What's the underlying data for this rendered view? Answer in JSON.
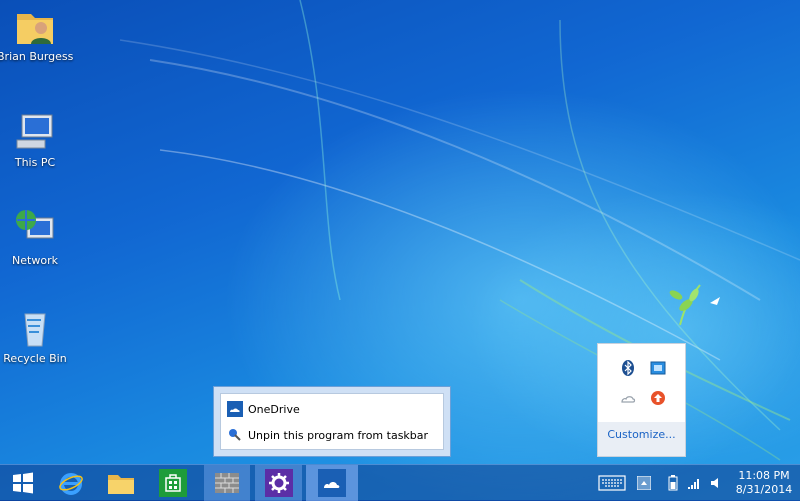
{
  "desktop": {
    "icons": [
      {
        "label": "Brian Burgess",
        "icon": "user-folder-icon"
      },
      {
        "label": "This PC",
        "icon": "computer-icon"
      },
      {
        "label": "Network",
        "icon": "network-globe-icon"
      },
      {
        "label": "Recycle Bin",
        "icon": "recycle-bin-icon"
      }
    ]
  },
  "jump_list": {
    "items": [
      {
        "label": "OneDrive",
        "icon": "onedrive-cloud-icon"
      },
      {
        "label": "Unpin this program from taskbar",
        "icon": "unpin-icon"
      }
    ]
  },
  "tray_overflow": {
    "icons": [
      "bluetooth-icon",
      "network-adapter-icon",
      "cloud-icon",
      "update-arrow-icon"
    ],
    "customize_label": "Customize..."
  },
  "taskbar": {
    "pinned": [
      "start-windows-icon",
      "internet-explorer-icon",
      "file-explorer-icon",
      "store-icon",
      "wall-app-icon",
      "settings-gear-icon",
      "onedrive-icon"
    ],
    "clock": {
      "time": "11:08 PM",
      "date": "8/31/2014"
    }
  },
  "colors": {
    "accent": "#1a63c5",
    "start_purple": "#5b2ea6",
    "store_green": "#1e9c3a"
  }
}
